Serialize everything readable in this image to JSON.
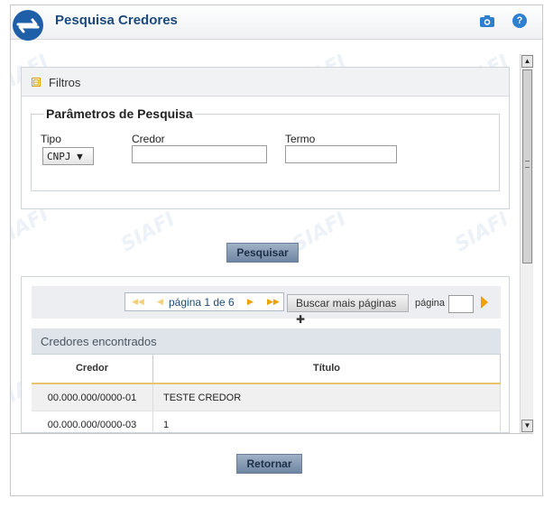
{
  "window": {
    "title": "Pesquisa Credores",
    "icons": {
      "logo": "siafi-logo",
      "camera": "camera-icon",
      "help": "help-icon"
    },
    "help_glyph": "?"
  },
  "filters": {
    "header": "Filtros",
    "toggle_glyph": "⊟",
    "legend": "Parâmetros de Pesquisa",
    "tipo_label": "Tipo",
    "tipo_value": "CNPJ ▼",
    "credor_label": "Credor",
    "credor_value": "",
    "termo_label": "Termo",
    "termo_value": ""
  },
  "search_button": "Pesquisar",
  "pager": {
    "first": "◀◀",
    "prev": "◀",
    "text": "página 1 de 6",
    "next": "▶",
    "last": "▶▶",
    "more_pages": "Buscar mais páginas ✚",
    "page_label": "página",
    "page_value": ""
  },
  "results": {
    "caption": "Credores encontrados",
    "columns": [
      "Credor",
      "Título"
    ],
    "rows": [
      [
        "00.000.000/0000-01",
        "TESTE CREDOR"
      ],
      [
        "00.000.000/0000-03",
        "1"
      ]
    ]
  },
  "return_button": "Retornar",
  "watermark": "SIAFI",
  "colors": {
    "title": "#1d4a7c",
    "accent": "#f0a000",
    "button": "#7d93ae"
  }
}
